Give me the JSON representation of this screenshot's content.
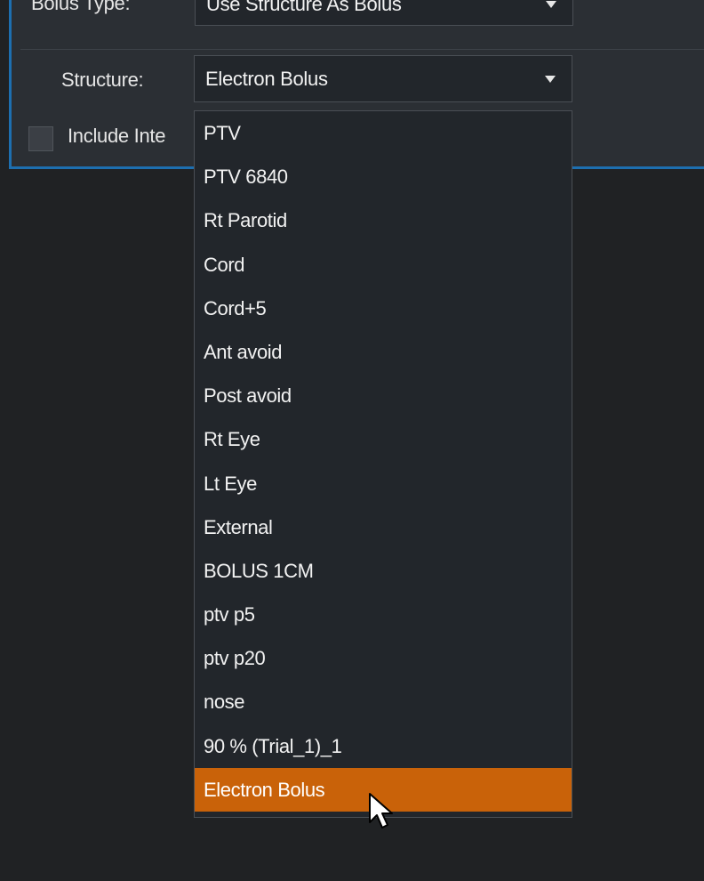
{
  "bolus_type": {
    "label": "Bolus Type:",
    "value": "Use Structure As Bolus"
  },
  "structure": {
    "label": "Structure:",
    "value": "Electron Bolus"
  },
  "include_checkbox": {
    "label": "Include Inte",
    "checked": false
  },
  "dropdown": {
    "items": [
      {
        "label": "PTV"
      },
      {
        "label": "PTV 6840"
      },
      {
        "label": "Rt Parotid"
      },
      {
        "label": "Cord"
      },
      {
        "label": "Cord+5"
      },
      {
        "label": "Ant avoid"
      },
      {
        "label": "Post avoid"
      },
      {
        "label": "Rt Eye"
      },
      {
        "label": "Lt Eye"
      },
      {
        "label": "External"
      },
      {
        "label": "BOLUS 1CM"
      },
      {
        "label": "ptv p5"
      },
      {
        "label": "ptv p20"
      },
      {
        "label": "nose"
      },
      {
        "label": "90 % (Trial_1)_1"
      },
      {
        "label": "Electron Bolus"
      }
    ],
    "selected_index": 15
  },
  "colors": {
    "panel_border": "#1d6fb0",
    "selected_item": "#c96209",
    "background": "#202224"
  },
  "icons": {
    "caret": "caret-down-icon",
    "cursor": "mouse-pointer-icon"
  }
}
